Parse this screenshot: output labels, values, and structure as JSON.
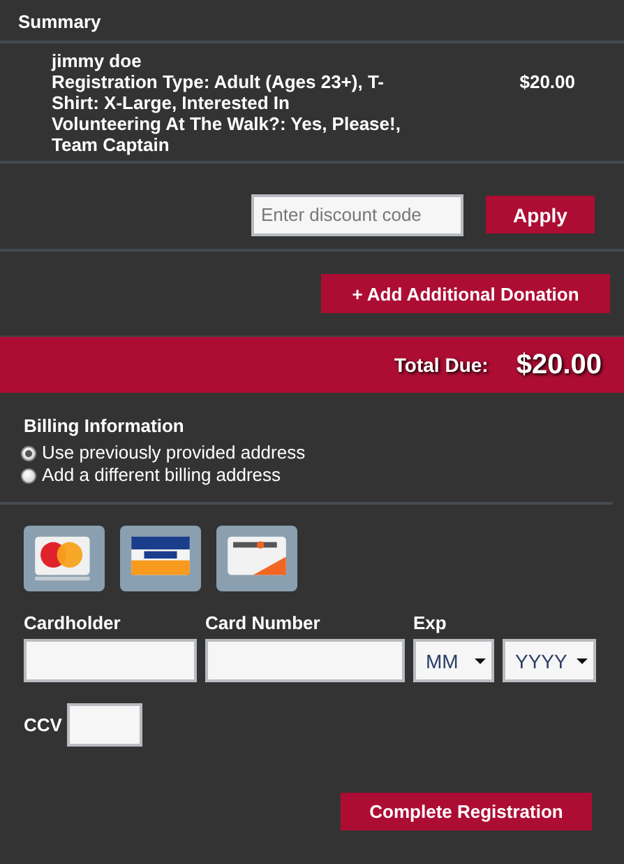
{
  "summary": {
    "title": "Summary",
    "items": [
      {
        "name": "jimmy doe",
        "details": "Registration Type: Adult (Ages 23+), T-Shirt: X-Large, Interested In Volunteering At The Walk?: Yes, Please!, Team Captain",
        "price": "$20.00"
      }
    ]
  },
  "discount": {
    "placeholder": "Enter discount code",
    "button": "Apply"
  },
  "donation_button": "+ Add Additional Donation",
  "total": {
    "label": "Total Due:",
    "amount": "$20.00"
  },
  "billing": {
    "title": "Billing Information",
    "options": [
      {
        "label": "Use previously provided address",
        "selected": true
      },
      {
        "label": "Add a different billing address",
        "selected": false
      }
    ]
  },
  "payment": {
    "cards": [
      {
        "kind": "mastercard"
      },
      {
        "kind": "visa"
      },
      {
        "kind": "discover"
      }
    ],
    "cardholder_label": "Cardholder",
    "card_number_label": "Card Number",
    "exp_label": "Exp",
    "month": "MM",
    "year": "YYYY",
    "ccv_label": "CCV",
    "submit": "Complete Registration"
  }
}
